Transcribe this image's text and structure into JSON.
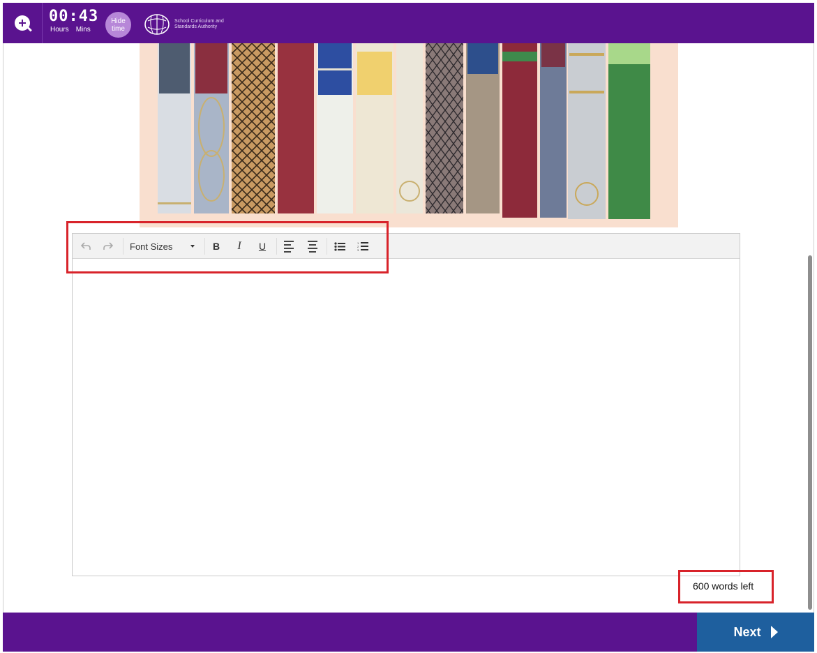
{
  "header": {
    "timer_hours": "00",
    "timer_sep": ":",
    "timer_mins": "43",
    "hours_label": "Hours",
    "mins_label": "Mins",
    "hide_time_label": "Hide time",
    "logo_text": "School Curriculum and Standards Authority"
  },
  "editor": {
    "font_sizes_label": "Font Sizes",
    "bold_label": "B",
    "italic_label": "I",
    "underline_label": "U",
    "words_left": "600 words left"
  },
  "footer": {
    "next_label": "Next"
  },
  "colors": {
    "brand_purple": "#5a138f",
    "next_blue": "#1e5f9e",
    "highlight_red": "#d8232a"
  }
}
